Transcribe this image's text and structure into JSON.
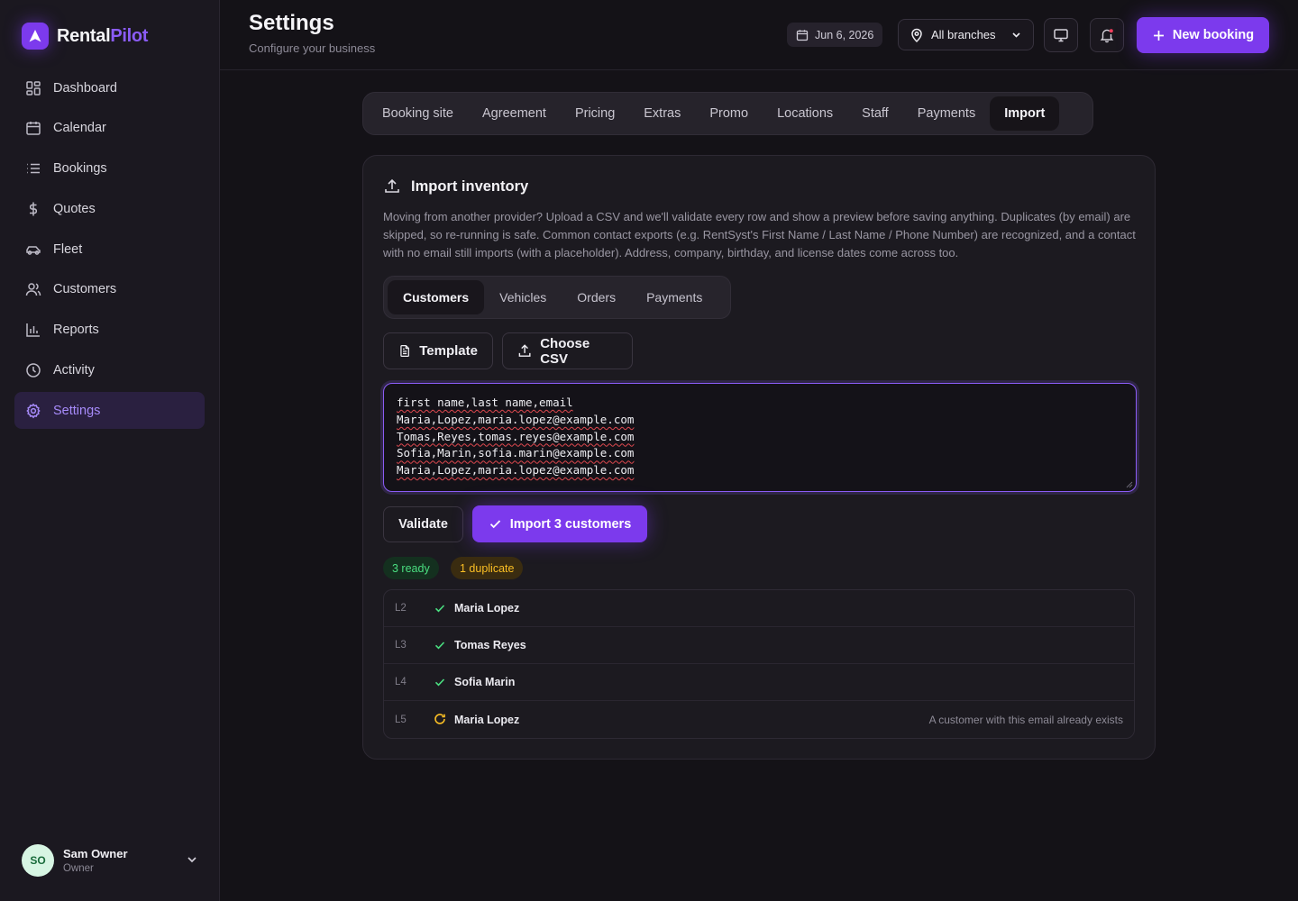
{
  "brand": {
    "name_part1": "Rental",
    "name_part2": "Pilot",
    "accent": "#7c3aed"
  },
  "sidebar": {
    "items": [
      {
        "label": "Dashboard",
        "icon": "grid-icon"
      },
      {
        "label": "Calendar",
        "icon": "calendar-icon"
      },
      {
        "label": "Bookings",
        "icon": "list-icon"
      },
      {
        "label": "Quotes",
        "icon": "dollar-icon"
      },
      {
        "label": "Fleet",
        "icon": "car-icon"
      },
      {
        "label": "Customers",
        "icon": "users-icon"
      },
      {
        "label": "Reports",
        "icon": "bar-chart-icon"
      },
      {
        "label": "Activity",
        "icon": "clock-icon"
      },
      {
        "label": "Settings",
        "icon": "gear-icon",
        "active": true
      }
    ],
    "user": {
      "initials": "SO",
      "name": "Sam Owner",
      "role": "Owner"
    }
  },
  "header": {
    "title": "Settings",
    "subtitle": "Configure your business",
    "date": "Jun 6, 2026",
    "branch": "All branches",
    "new_booking": "New booking"
  },
  "tabs": [
    "Booking site",
    "Agreement",
    "Pricing",
    "Extras",
    "Promo",
    "Locations",
    "Staff",
    "Payments",
    "Import"
  ],
  "active_tab": "Import",
  "import": {
    "title": "Import inventory",
    "description": "Moving from another provider? Upload a CSV and we'll validate every row and show a preview before saving anything. Duplicates (by email) are skipped, so re-running is safe. Common contact exports (e.g. RentSyst's First Name / Last Name / Phone Number) are recognized, and a contact with no email still imports (with a placeholder). Address, company, birthday, and license dates come across too.",
    "subtabs": [
      "Customers",
      "Vehicles",
      "Orders",
      "Payments"
    ],
    "active_subtab": "Customers",
    "template_label": "Template",
    "choose_csv_label": "Choose CSV",
    "csv_lines": [
      "first name,last name,email",
      "Maria,Lopez,maria.lopez@example.com",
      "Tomas,Reyes,tomas.reyes@example.com",
      "Sofia,Marin,sofia.marin@example.com",
      "Maria,Lopez,maria.lopez@example.com"
    ],
    "validate_label": "Validate",
    "import_label": "Import 3 customers",
    "badge_ready": "3 ready",
    "badge_duplicate": "1 duplicate",
    "rows": [
      {
        "line": "L2",
        "name": "Maria Lopez",
        "status": "ok",
        "note": ""
      },
      {
        "line": "L3",
        "name": "Tomas Reyes",
        "status": "ok",
        "note": ""
      },
      {
        "line": "L4",
        "name": "Sofia Marin",
        "status": "ok",
        "note": ""
      },
      {
        "line": "L5",
        "name": "Maria Lopez",
        "status": "duplicate",
        "note": "A customer with this email already exists"
      }
    ]
  }
}
